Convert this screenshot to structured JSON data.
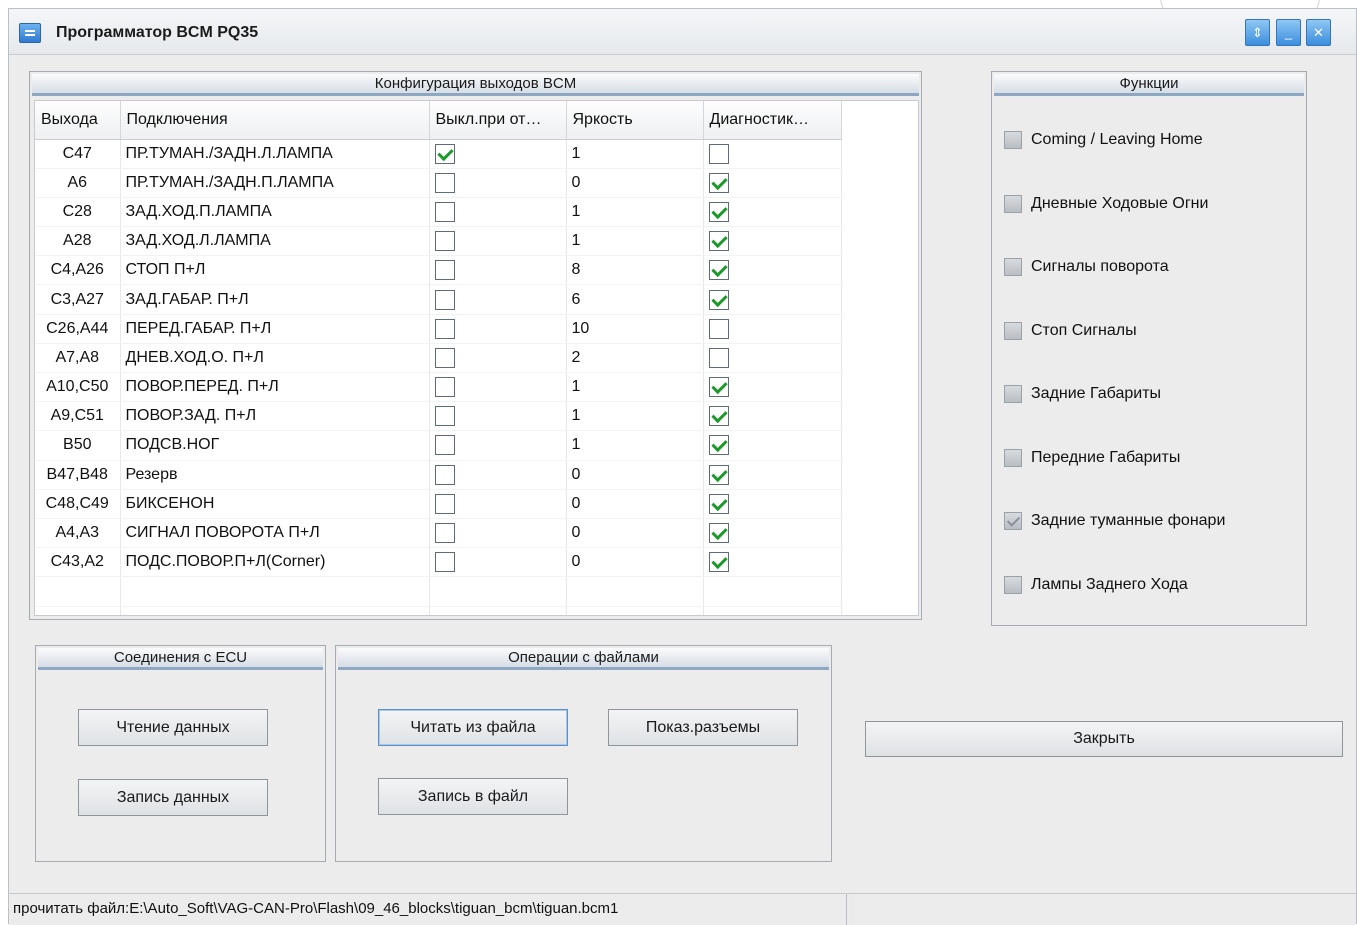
{
  "window": {
    "title": "Программатор BCM PQ35",
    "controls": {
      "restore": "⇕",
      "minimize": "_",
      "close": "✕"
    }
  },
  "config": {
    "title": "Конфигурация выходов BCM",
    "columns": [
      "Выхода",
      "Подключения",
      "Выкл.при от…",
      "Яркость",
      "Диагностик…"
    ],
    "rows": [
      {
        "out": "C47",
        "conn": "ПР.ТУМАН./ЗАДН.Л.ЛАМПА",
        "off": true,
        "bright": "1",
        "diag": false
      },
      {
        "out": "A6",
        "conn": "ПР.ТУМАН./ЗАДН.П.ЛАМПА",
        "off": false,
        "bright": "0",
        "diag": true
      },
      {
        "out": "C28",
        "conn": "ЗАД.ХОД.П.ЛАМПА",
        "off": false,
        "bright": "1",
        "diag": true
      },
      {
        "out": "A28",
        "conn": "ЗАД.ХОД.Л.ЛАМПА",
        "off": false,
        "bright": "1",
        "diag": true
      },
      {
        "out": "C4,A26",
        "conn": "СТОП П+Л",
        "off": false,
        "bright": "8",
        "diag": true
      },
      {
        "out": "C3,A27",
        "conn": "ЗАД.ГАБАР. П+Л",
        "off": false,
        "bright": "6",
        "diag": true
      },
      {
        "out": "C26,A44",
        "conn": "ПЕРЕД.ГАБАР. П+Л",
        "off": false,
        "bright": "10",
        "diag": false
      },
      {
        "out": "A7,A8",
        "conn": "ДНЕВ.ХОД.О. П+Л",
        "off": false,
        "bright": "2",
        "diag": false
      },
      {
        "out": "A10,C50",
        "conn": "ПОВОР.ПЕРЕД. П+Л",
        "off": false,
        "bright": "1",
        "diag": true
      },
      {
        "out": "A9,C51",
        "conn": "ПОВОР.ЗАД. П+Л",
        "off": false,
        "bright": "1",
        "diag": true
      },
      {
        "out": "B50",
        "conn": "ПОДСВ.НОГ",
        "off": false,
        "bright": "1",
        "diag": true
      },
      {
        "out": "B47,B48",
        "conn": "Резерв",
        "off": false,
        "bright": "0",
        "diag": true
      },
      {
        "out": "C48,C49",
        "conn": "БИКСЕНОН",
        "off": false,
        "bright": "0",
        "diag": true
      },
      {
        "out": "A4,A3",
        "conn": "СИГНАЛ ПОВОРОТА П+Л",
        "off": false,
        "bright": "0",
        "diag": true
      },
      {
        "out": "C43,A2",
        "conn": "ПОДС.ПОВОР.П+Л(Corner)",
        "off": false,
        "bright": "0",
        "diag": true
      }
    ]
  },
  "functions": {
    "title": "Функции",
    "items": [
      {
        "label": "Coming / Leaving Home",
        "checked": false
      },
      {
        "label": "Дневные Ходовые Огни",
        "checked": false
      },
      {
        "label": "Сигналы поворота",
        "checked": false
      },
      {
        "label": "Стоп Сигналы",
        "checked": false
      },
      {
        "label": "Задние Габариты",
        "checked": false
      },
      {
        "label": "Передние Габариты",
        "checked": false
      },
      {
        "label": "Задние туманные фонари",
        "checked": true
      },
      {
        "label": "Лампы Заднего Хода",
        "checked": false
      }
    ]
  },
  "ecu": {
    "title": "Соединения с ECU",
    "read_button": "Чтение данных",
    "write_button": "Запись данных"
  },
  "files": {
    "title": "Операции с файлами",
    "read_file_button": "Читать из файла",
    "show_connectors_button": "Показ.разъемы",
    "write_file_button": "Запись в файл"
  },
  "close_button": "Закрыть",
  "status": {
    "text": "прочитать файл:E:\\Auto_Soft\\VAG-CAN-Pro\\Flash\\09_46_blocks\\tiguan_bcm\\tiguan.bcm1",
    "right": ""
  }
}
